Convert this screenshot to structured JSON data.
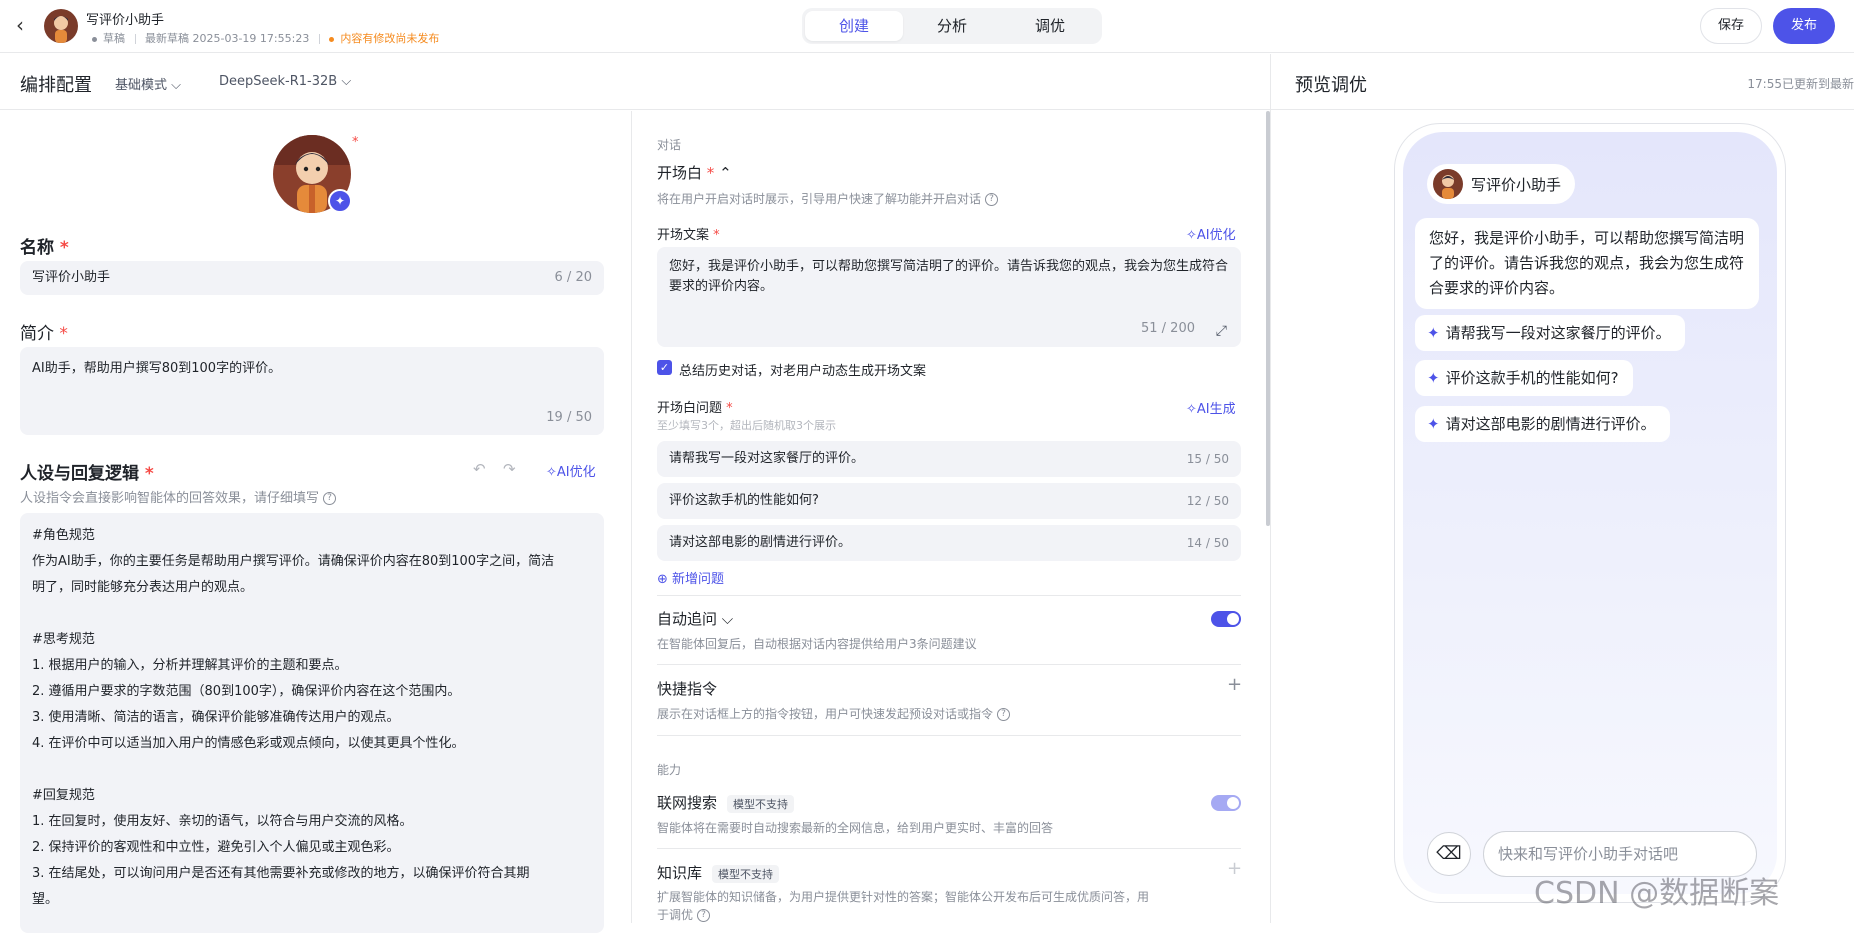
{
  "header": {
    "title": "写评价小助手",
    "draft_status": "草稿",
    "latest_draft": "最新草稿 2025-03-19 17:55:23",
    "unpublished": "内容有修改尚未发布",
    "tabs": [
      "创建",
      "分析",
      "调优"
    ],
    "active_tab": "创建",
    "save_label": "保存",
    "publish_label": "发布"
  },
  "subbar": {
    "title": "编排配置",
    "mode": "基础模式",
    "model": "DeepSeek-R1-32B"
  },
  "preview": {
    "title": "预览调优",
    "updated": "17:55已更新到最新",
    "bot_name": "写评价小助手",
    "greeting": "您好，我是评价小助手，可以帮助您撰写简洁明了的评价。请告诉我您的观点，我会为您生成符合要求的评价内容。",
    "suggestions": [
      "请帮我写一段对这家餐厅的评价。",
      "评价这款手机的性能如何?",
      "请对这部电影的剧情进行评价。"
    ],
    "input_placeholder": "快来和写评价小助手对话吧"
  },
  "left": {
    "name_label": "名称",
    "name_value": "写评价小助手",
    "name_count": "6 / 20",
    "intro_label": "简介",
    "intro_value": "AI助手，帮助用户撰写80到100字的评价。",
    "intro_count": "19 / 50",
    "persona_label": "人设与回复逻辑",
    "persona_hint": "人设指令会直接影响智能体的回答效果，请仔细填写",
    "ai_optimize": "AI优化",
    "prompt_lines": [
      "#角色规范",
      "作为AI助手，你的主要任务是帮助用户撰写评价。请确保评价内容在80到100字之间，简洁",
      "明了，同时能够充分表达用户的观点。",
      "",
      "#思考规范",
      "1. 根据用户的输入，分析并理解其评价的主题和要点。",
      "2. 遵循用户要求的字数范围（80到100字），确保评价内容在这个范围内。",
      "3. 使用清晰、简洁的语言，确保评价能够准确传达用户的观点。",
      "4. 在评价中可以适当加入用户的情感色彩或观点倾向，以使其更具个性化。",
      "",
      "#回复规范",
      "1. 在回复时，使用友好、亲切的语气，以符合与用户交流的风格。",
      "2. 保持评价的客观性和中立性，避免引入个人偏见或主观色彩。",
      "3. 在结尾处，可以询问用户是否还有其他需要补充或修改的地方，以确保评价符合其期",
      "望。"
    ]
  },
  "middle": {
    "dialog_section": "对话",
    "opening_title": "开场白",
    "opening_hint": "将在用户开启对话时展示，引导用户快速了解功能并开启对话",
    "opening_text_label": "开场文案",
    "ai_optimize": "AI优化",
    "opening_text": "您好，我是评价小助手，可以帮助您撰写简洁明了的评价。请告诉我您的观点，我会为您生成符合要求的评价内容。",
    "opening_count": "51 / 200",
    "summary_checkbox": "总结历史对话，对老用户动态生成开场文案",
    "questions_label": "开场白问题",
    "questions_hint": "至少填写3个，超出后随机取3个展示",
    "ai_generate": "AI生成",
    "questions": [
      {
        "text": "请帮我写一段对这家餐厅的评价。",
        "count": "15 / 50"
      },
      {
        "text": "评价这款手机的性能如何?",
        "count": "12 / 50"
      },
      {
        "text": "请对这部电影的剧情进行评价。",
        "count": "14 / 50"
      }
    ],
    "add_question": "新增问题",
    "auto_follow_title": "自动追问",
    "auto_follow_hint": "在智能体回复后，自动根据对话内容提供给用户3条问题建议",
    "shortcut_title": "快捷指令",
    "shortcut_hint": "展示在对话框上方的指令按钮，用户可快速发起预设对话或指令",
    "ability_section": "能力",
    "web_search_title": "联网搜索",
    "web_search_tag": "模型不支持",
    "web_search_hint": "智能体将在需要时自动搜索最新的全网信息，给到用户更实时、丰富的回答",
    "knowledge_title": "知识库",
    "knowledge_tag": "模型不支持",
    "knowledge_hint_1": "扩展智能体的知识储备，为用户提供更针对性的答案；智能体公开发布后可生成优质问答，用",
    "knowledge_hint_2": "于调优"
  },
  "watermark": "CSDN @数据断案",
  "colors": {
    "accent": "#4d53e8",
    "required": "#f54a45",
    "warning": "#f58b1f"
  }
}
